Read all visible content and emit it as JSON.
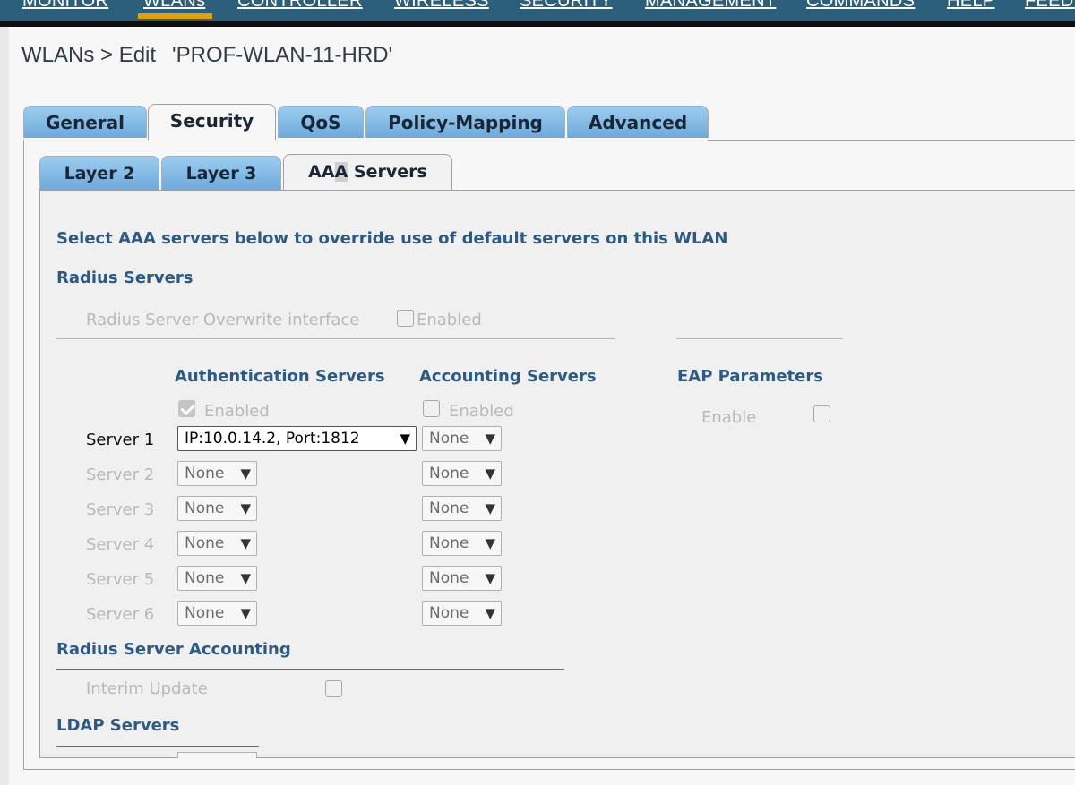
{
  "top_menu": {
    "items": [
      {
        "label": "MONITOR"
      },
      {
        "label": "WLANs",
        "active": true
      },
      {
        "label": "CONTROLLER"
      },
      {
        "label": "WIRELESS"
      },
      {
        "label": "SECURITY"
      },
      {
        "label": "MANAGEMENT"
      },
      {
        "label": "COMMANDS"
      },
      {
        "label": "HELP"
      },
      {
        "label": "FEEDBACK"
      }
    ]
  },
  "page": {
    "title": "WLANs > Edit",
    "wlan_name": "'PROF-WLAN-11-HRD'"
  },
  "tabs": [
    {
      "label": "General"
    },
    {
      "label": "Security",
      "active": true
    },
    {
      "label": "QoS"
    },
    {
      "label": "Policy-Mapping"
    },
    {
      "label": "Advanced"
    }
  ],
  "subtabs": [
    {
      "label": "Layer 2"
    },
    {
      "label": "Layer 3"
    },
    {
      "label": "AAA Servers",
      "active": true
    }
  ],
  "aaa": {
    "intro": "Select AAA servers below to override use of default servers on this WLAN",
    "radius_servers_heading": "Radius Servers",
    "overwrite_label": "Radius Server Overwrite interface",
    "overwrite_enabled_label": "Enabled",
    "overwrite_checked": false,
    "auth_heading": "Authentication Servers",
    "acct_heading": "Accounting Servers",
    "eap_heading": "EAP Parameters",
    "auth_enabled_label": "Enabled",
    "auth_enabled_checked": true,
    "acct_enabled_label": "Enabled",
    "acct_enabled_checked": false,
    "eap_enable_label": "Enable",
    "eap_enable_checked": false,
    "servers": [
      {
        "label": "Server 1",
        "auth": "IP:10.0.14.2, Port:1812",
        "acct": "None"
      },
      {
        "label": "Server 2",
        "auth": "None",
        "acct": "None"
      },
      {
        "label": "Server 3",
        "auth": "None",
        "acct": "None"
      },
      {
        "label": "Server 4",
        "auth": "None",
        "acct": "None"
      },
      {
        "label": "Server 5",
        "auth": "None",
        "acct": "None"
      },
      {
        "label": "Server 6",
        "auth": "None",
        "acct": "None"
      }
    ],
    "accounting_heading": "Radius Server Accounting",
    "interim_update_label": "Interim Update",
    "interim_update_checked": false,
    "ldap_heading": "LDAP Servers"
  },
  "icons": {
    "dropdown": "chevron-down-icon",
    "checkbox": "checkbox-icon"
  },
  "colors": {
    "menu_bg": "#2c5f7c",
    "menu_active": "#e6a000",
    "tab_blue": "#7fb6e2",
    "heading": "#2a5a85"
  }
}
